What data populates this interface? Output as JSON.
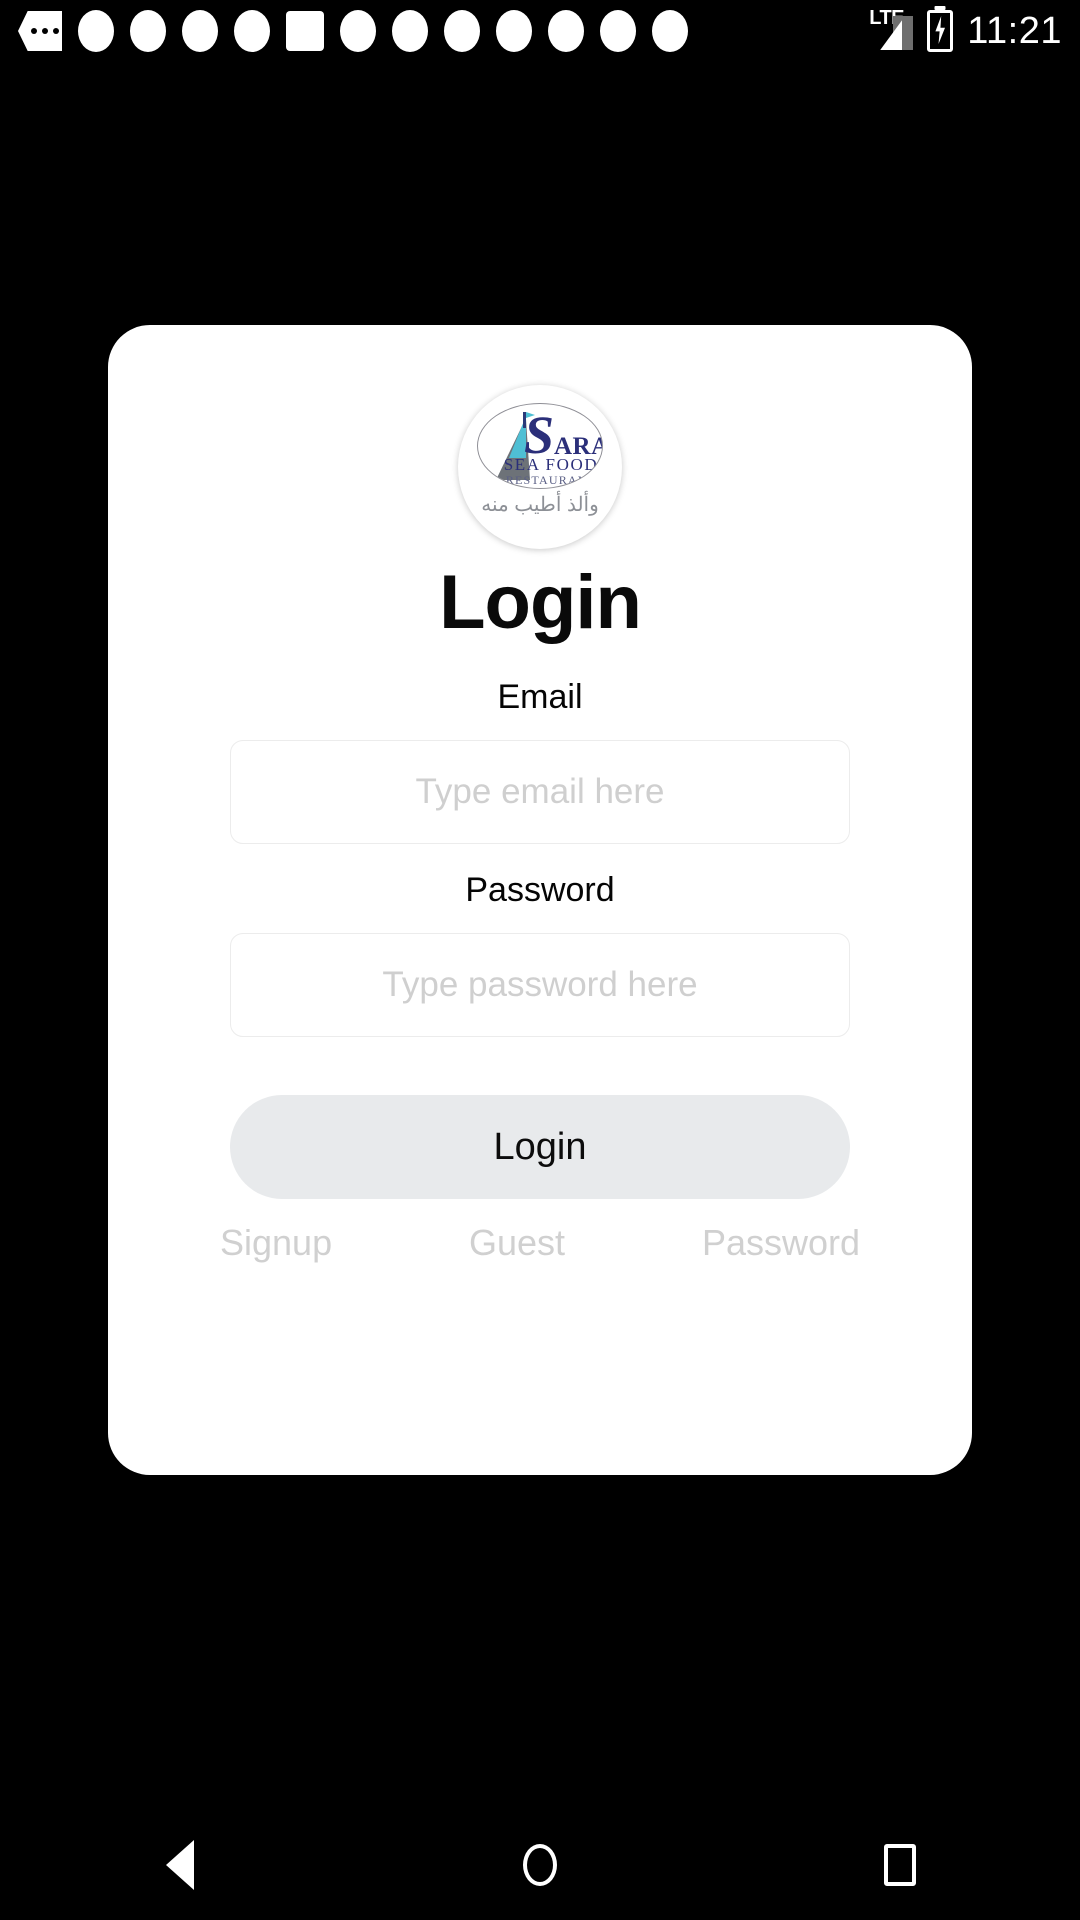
{
  "status_bar": {
    "time": "11:21",
    "network_label": "LTE",
    "notification_icons": [
      "overflow-dots-icon",
      "circle-notification-icon",
      "circle-notification-icon",
      "circle-notification-icon",
      "circle-notification-icon",
      "square-notification-icon",
      "circle-notification-icon",
      "circle-notification-icon",
      "circle-notification-icon",
      "circle-notification-icon",
      "circle-notification-icon",
      "circle-notification-icon",
      "circle-notification-icon"
    ],
    "signal_icon": "lte-signal-icon",
    "battery_icon": "battery-charging-icon"
  },
  "card": {
    "logo": {
      "brand_initial": "S",
      "brand_rest": "ARA",
      "line_seafood": "SEA FOOD",
      "line_restaurant": "RESTAURANT",
      "arabic_tagline": "وألذ أطيب منه",
      "colors": {
        "brand_navy": "#2b2f7a",
        "sail_teal": "#4fbfd4",
        "sail_grey": "#6d7278"
      }
    },
    "title": "Login",
    "fields": [
      {
        "label": "Email",
        "placeholder": "Type email here",
        "value": ""
      },
      {
        "label": "Password",
        "placeholder": "Type password here",
        "value": ""
      }
    ],
    "submit_label": "Login",
    "links": [
      {
        "label": "Signup"
      },
      {
        "label": "Guest"
      },
      {
        "label": "Password"
      }
    ],
    "colors": {
      "card_bg": "#ffffff",
      "button_bg": "#e8eaec",
      "input_border": "#ececec",
      "placeholder": "#cfcfcf",
      "link": "#d0d0d0",
      "screen_bg": "#000000"
    }
  },
  "nav_bar": {
    "back_icon": "triangle-back-icon",
    "home_icon": "circle-home-icon",
    "recents_icon": "square-recents-icon"
  }
}
